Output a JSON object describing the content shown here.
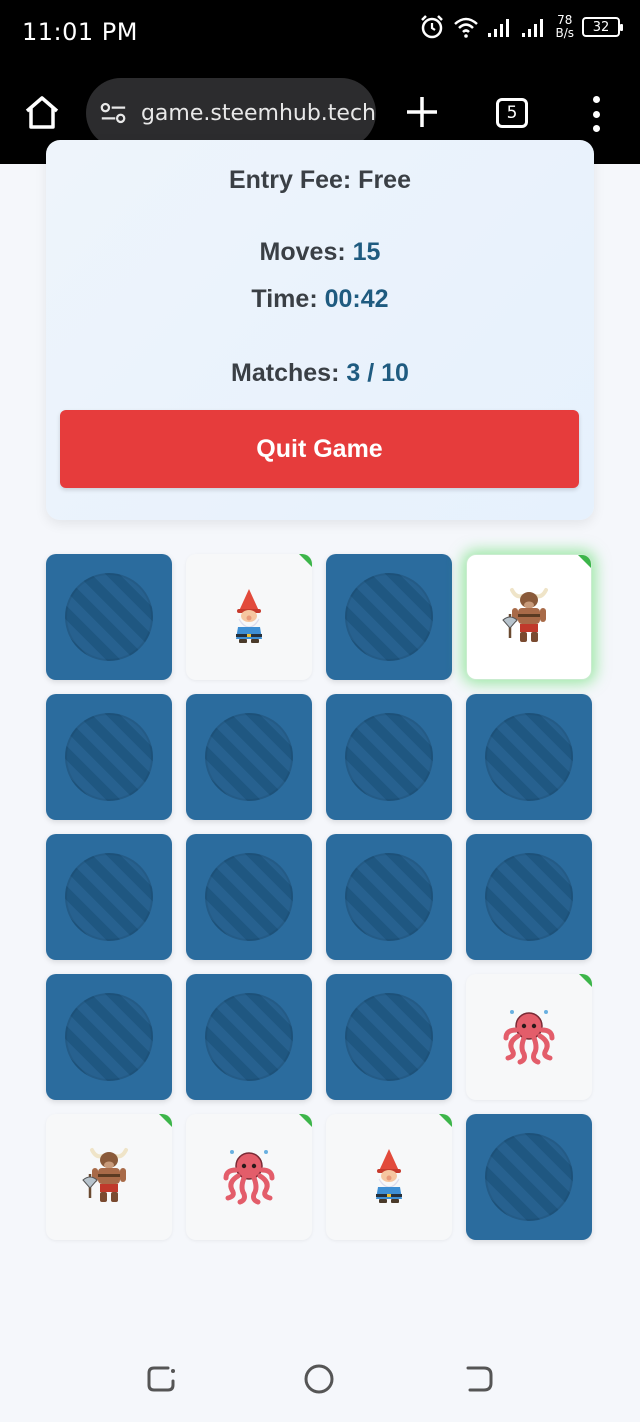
{
  "status": {
    "time": "11:01 PM",
    "speed_value": "78",
    "speed_unit": "B/s",
    "battery": "32"
  },
  "browser": {
    "url": "game.steemhub.tech",
    "tab_count": "5"
  },
  "game": {
    "entry_fee_label": "Entry Fee: Free",
    "moves_label": "Moves:",
    "moves_value": "15",
    "time_label": "Time:",
    "time_value": "00:42",
    "matches_label": "Matches:",
    "matches_value": "3 / 10",
    "quit_label": "Quit Game"
  },
  "cards": [
    {
      "state": "hidden"
    },
    {
      "state": "matched",
      "icon": "gnome-icon"
    },
    {
      "state": "hidden"
    },
    {
      "state": "flipped",
      "icon": "minotaur-icon"
    },
    {
      "state": "hidden"
    },
    {
      "state": "hidden"
    },
    {
      "state": "hidden"
    },
    {
      "state": "hidden"
    },
    {
      "state": "hidden"
    },
    {
      "state": "hidden"
    },
    {
      "state": "hidden"
    },
    {
      "state": "hidden"
    },
    {
      "state": "hidden"
    },
    {
      "state": "hidden"
    },
    {
      "state": "hidden"
    },
    {
      "state": "matched",
      "icon": "octopus-icon"
    },
    {
      "state": "matched",
      "icon": "minotaur-icon"
    },
    {
      "state": "matched",
      "icon": "octopus-icon"
    },
    {
      "state": "matched",
      "icon": "gnome-icon"
    },
    {
      "state": "hidden"
    }
  ],
  "colors": {
    "card_back": "#2b6c9e",
    "quit_button": "#e63c3c",
    "stat_value": "#1f5b80",
    "match_corner": "#3cb54a"
  }
}
